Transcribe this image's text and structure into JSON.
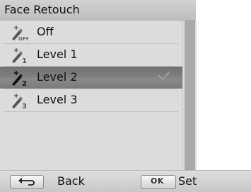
{
  "title": "Face Retouch",
  "options": [
    {
      "label": "Off",
      "icon": "retouch-off-icon",
      "selected": false
    },
    {
      "label": "Level 1",
      "icon": "retouch-level-1-icon",
      "selected": false
    },
    {
      "label": "Level 2",
      "icon": "retouch-level-2-icon",
      "selected": true
    },
    {
      "label": "Level 3",
      "icon": "retouch-level-3-icon",
      "selected": false
    }
  ],
  "footer": {
    "back_label": "Back",
    "ok_key": "OK",
    "set_label": "Set"
  },
  "colors": {
    "panel": "#dcdcdc",
    "selected_row": "#7a7a7a",
    "check": "#9a9a9a"
  }
}
